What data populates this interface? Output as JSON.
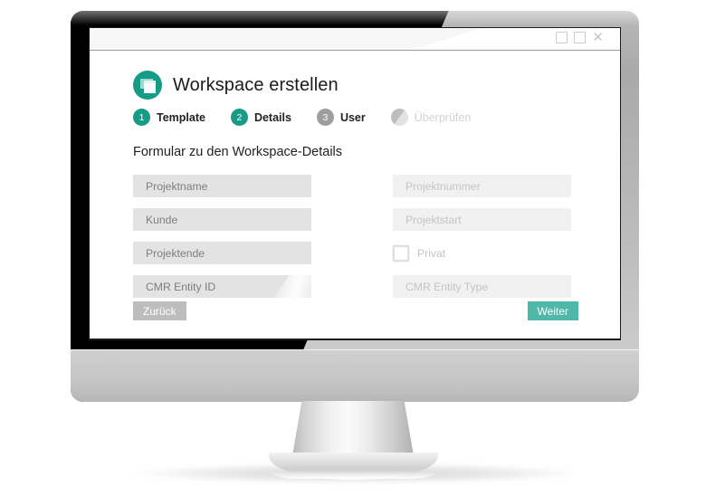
{
  "window": {
    "controls": [
      {
        "name": "restore",
        "glyph": "square"
      },
      {
        "name": "maximize",
        "glyph": "square"
      },
      {
        "name": "close",
        "glyph": "✕"
      }
    ]
  },
  "dialog": {
    "logo_icon": "workspace-windows-icon",
    "title": "Workspace erstellen",
    "accent_color": "#159b86",
    "stepper": [
      {
        "number": "1",
        "label": "Template",
        "state": "active"
      },
      {
        "number": "2",
        "label": "Details",
        "state": "active"
      },
      {
        "number": "3",
        "label": "User",
        "state": "idle"
      },
      {
        "number": "",
        "label": "Überprüfen",
        "state": "ghost"
      }
    ],
    "form_heading": "Formular zu den Workspace-Details",
    "fields_left": [
      {
        "placeholder": "Projektname",
        "value": "",
        "faded": false,
        "shine": false
      },
      {
        "placeholder": "Kunde",
        "value": "",
        "faded": false,
        "shine": false
      },
      {
        "placeholder": "Projektende",
        "value": "",
        "faded": false,
        "shine": false
      },
      {
        "placeholder": "CMR Entity ID",
        "value": "",
        "faded": false,
        "shine": true
      }
    ],
    "fields_right": [
      {
        "placeholder": "Projektnummer",
        "value": "",
        "faded": true,
        "shine": false
      },
      {
        "placeholder": "Projektstart",
        "value": "",
        "faded": true,
        "shine": false
      }
    ],
    "checkbox": {
      "label": "Privat",
      "checked": false
    },
    "field_right_last": {
      "placeholder": "CMR Entity Type",
      "value": "",
      "faded": true,
      "shine": false
    },
    "footer": {
      "back_label": "Zurück",
      "back_color": "#bdbdbd",
      "next_label": "Weiter",
      "next_color": "#4fb8a8"
    }
  }
}
